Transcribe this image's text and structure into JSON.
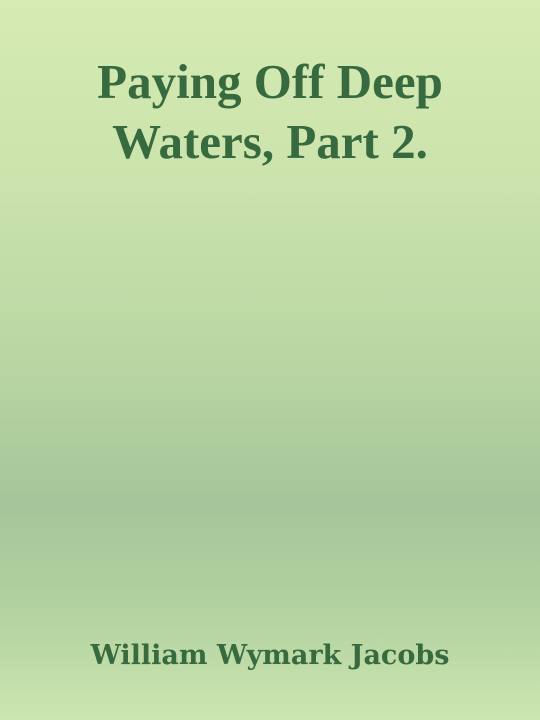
{
  "cover": {
    "title_lines": [
      "Paying Off Deep",
      "Waters, Part 2."
    ],
    "author": "William Wymark Jacobs"
  },
  "colors": {
    "text": "#386a3f",
    "background_top": "#d6ebb4",
    "background_middle": "#a5c69a",
    "background_bottom": "#cde6b0"
  }
}
